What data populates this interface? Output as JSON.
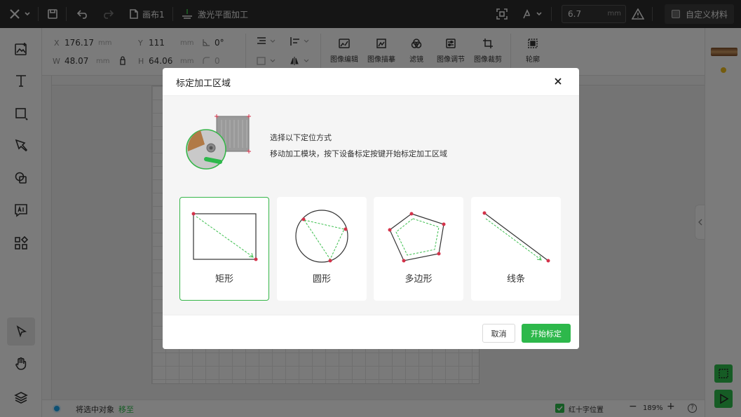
{
  "topbar": {
    "canvas_name": "画布1",
    "process_mode": "激光平面加工",
    "power_value": "6.7",
    "power_unit": "mm",
    "material_label": "自定义材料",
    "icons": [
      "close-x-icon",
      "save-icon",
      "undo-icon",
      "redo-icon",
      "file-icon",
      "laser-icon",
      "scan-frame-icon",
      "tool-select-icon",
      "material-warning-icon"
    ]
  },
  "properties": {
    "x_label": "X",
    "x_value": "176.17",
    "x_unit": "mm",
    "y_label": "Y",
    "y_value": "111",
    "y_unit": "mm",
    "w_label": "W",
    "w_value": "48.07",
    "w_unit": "mm",
    "h_label": "H",
    "h_value": "64.06",
    "h_unit": "mm",
    "angle_value": "0°",
    "corner_value": "0"
  },
  "image_tools": [
    {
      "label": "图像编辑",
      "icon": "image-edit-icon"
    },
    {
      "label": "图像描摹",
      "icon": "image-trace-icon"
    },
    {
      "label": "滤镜",
      "icon": "filter-icon"
    },
    {
      "label": "图像调节",
      "icon": "image-adjust-icon"
    },
    {
      "label": "图像裁剪",
      "icon": "crop-icon"
    },
    {
      "label": "轮廓",
      "icon": "outline-icon"
    }
  ],
  "status": {
    "select_text": "将选中对象",
    "move_link": "移至",
    "crosshair_label": "红十字位置",
    "zoom": "189%",
    "help": "?"
  },
  "dialog": {
    "title": "标定加工区域",
    "description_1": "选择以下定位方式",
    "description_2": "移动加工模块，按下设备标定按键开始标定加工区域",
    "options": [
      {
        "label": "矩形",
        "selected": true
      },
      {
        "label": "圆形",
        "selected": false
      },
      {
        "label": "多边形",
        "selected": false
      },
      {
        "label": "线条",
        "selected": false
      }
    ],
    "cancel_label": "取消",
    "start_label": "开始标定"
  },
  "colors": {
    "accent_green": "#2db84b",
    "point_red": "#d4334a",
    "topbar_bg": "#2b2b2b"
  }
}
